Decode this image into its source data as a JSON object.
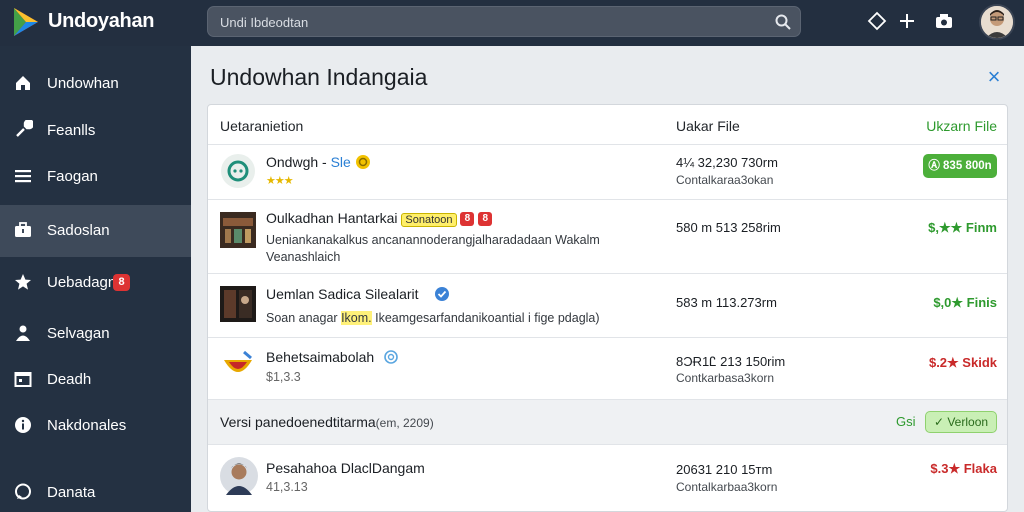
{
  "app": {
    "title": "Undoyahan"
  },
  "search": {
    "value": "Undi Ibdeodtan"
  },
  "icons": {
    "top": [
      "diamond-icon",
      "plus-icon",
      "camera-icon"
    ],
    "search": "search-icon"
  },
  "sidebar": {
    "items": [
      {
        "label": "Undowhan",
        "icon": "home-icon"
      },
      {
        "label": "Feanlls",
        "icon": "wrench-icon"
      },
      {
        "label": "Faogan",
        "icon": "list-icon"
      },
      {
        "label": "Sadoslan",
        "icon": "briefcase-icon",
        "active": true
      },
      {
        "label": "Uebadagn",
        "icon": "star-icon",
        "badge": "8"
      },
      {
        "label": "Selvagan",
        "icon": "person-icon"
      },
      {
        "label": "Deadh",
        "icon": "calendar-icon"
      },
      {
        "label": "Nakdonales",
        "icon": "info-icon"
      },
      {
        "label": "Danata",
        "icon": "chat-icon"
      }
    ]
  },
  "main": {
    "title": "Undowhan Indangaia",
    "close": "×"
  },
  "table": {
    "headers": {
      "left": "Uetaranietion",
      "mid": "Uakar File",
      "right": "Ukzarn File"
    },
    "rows": [
      {
        "title": "Ondwgh - ",
        "title_extra": "Sle",
        "stars": "★★★",
        "mid1": "4¼ 32,230 730rm",
        "mid2": "Contalkaraa3okan",
        "action": "Ⓐ 835 800n",
        "action_style": "pill"
      },
      {
        "title": "Oulkadhan Hantarkai",
        "tag": "Sonatoon",
        "badges": [
          "8",
          "8"
        ],
        "sub1": "Ueniankanakalkus ancanannoderangjalharadadaan Wakalm",
        "sub2": "Veanashlaich",
        "mid1": "580 m 513 258rim",
        "action": "$,★★ Finm",
        "action_style": "green"
      },
      {
        "title": "Uemlan Sadica Silealarit",
        "sub_pre": "Soan anagar ",
        "sub_hl": "Ikom.",
        "sub_post": " Ikeamgesarfandanikoantial i fige pdagla)",
        "mid1": "583 m 113.273rm",
        "action": "$,0★ Finis",
        "action_style": "green"
      },
      {
        "title": "Behetsaimabolah",
        "sub1": "$1,3.3",
        "mid1": "8ƆɌ1Ꮭ 213 150rim",
        "mid2": "Contkarbasa3korn",
        "action": "$.2★ Skidk",
        "action_style": "red"
      }
    ],
    "version": {
      "label": "Versi panedoenedtitarma",
      "label_small": "(em, 2209)",
      "gear": "Gsi",
      "button": "✓ Verloon"
    },
    "last_row": {
      "title": "Pesahahoa DlaclDangam",
      "sub1": "41,3.13",
      "mid1": "20631 210 15ᴛm",
      "mid2": "Contalkarbaa3korn",
      "action": "$.3★ Flaka",
      "action_style": "red"
    }
  }
}
